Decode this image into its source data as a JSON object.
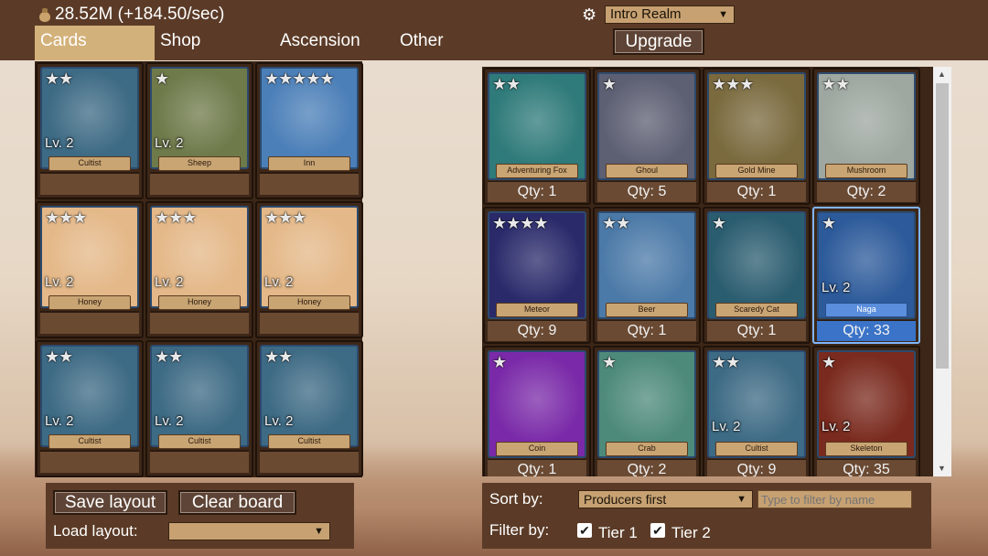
{
  "header": {
    "money_icon": "money-bag-icon",
    "money_text": "28.52M (+184.50/sec)",
    "tabs": [
      "Cards",
      "Shop",
      "Ascension",
      "Other"
    ],
    "settings_icon": "gear-icon",
    "realm_selected": "Intro Realm",
    "upgrade_label": "Upgrade"
  },
  "board": {
    "cards": [
      {
        "name": "Cultist",
        "stars": "★★",
        "level": "Lv. 2",
        "art": "#3d6a84"
      },
      {
        "name": "Sheep",
        "stars": "★",
        "level": "Lv. 2",
        "art": "#6e7a4a"
      },
      {
        "name": "Inn",
        "stars": "★★★★★",
        "level": "",
        "art": "#4b7fb8"
      },
      {
        "name": "Honey",
        "stars": "★★★",
        "level": "Lv. 2",
        "art": "#e4b888"
      },
      {
        "name": "Honey",
        "stars": "★★★",
        "level": "Lv. 2",
        "art": "#e4b888"
      },
      {
        "name": "Honey",
        "stars": "★★★",
        "level": "Lv. 2",
        "art": "#e4b888"
      },
      {
        "name": "Cultist",
        "stars": "★★",
        "level": "Lv. 2",
        "art": "#3d6a84"
      },
      {
        "name": "Cultist",
        "stars": "★★",
        "level": "Lv. 2",
        "art": "#3d6a84"
      },
      {
        "name": "Cultist",
        "stars": "★★",
        "level": "Lv. 2",
        "art": "#3d6a84"
      }
    ]
  },
  "collection": {
    "cards": [
      {
        "name": "Adventuring Fox",
        "stars": "★★",
        "level": "",
        "qty": "Qty: 1",
        "art": "#2f7a7a"
      },
      {
        "name": "Ghoul",
        "stars": "★",
        "level": "",
        "qty": "Qty: 5",
        "art": "#5d5f73"
      },
      {
        "name": "Gold Mine",
        "stars": "★★★",
        "level": "",
        "qty": "Qty: 1",
        "art": "#7a6a3e"
      },
      {
        "name": "Mushroom",
        "stars": "★★",
        "level": "",
        "qty": "Qty: 2",
        "art": "#9ea7a0"
      },
      {
        "name": "Meteor",
        "stars": "★★★★",
        "level": "",
        "qty": "Qty: 9",
        "art": "#2a2a6b"
      },
      {
        "name": "Beer",
        "stars": "★★",
        "level": "",
        "qty": "Qty: 1",
        "art": "#4c7aa8"
      },
      {
        "name": "Scaredy Cat",
        "stars": "★",
        "level": "",
        "qty": "Qty: 1",
        "art": "#2b5d70"
      },
      {
        "name": "Naga",
        "stars": "★",
        "level": "Lv. 2",
        "qty": "Qty: 33",
        "art": "#2c5a9a",
        "highlight": true
      },
      {
        "name": "Coin",
        "stars": "★",
        "level": "",
        "qty": "Qty: 1",
        "art": "#7a2aa8"
      },
      {
        "name": "Crab",
        "stars": "★",
        "level": "",
        "qty": "Qty: 2",
        "art": "#4d8a7a"
      },
      {
        "name": "Cultist",
        "stars": "★★",
        "level": "Lv. 2",
        "qty": "Qty: 9",
        "art": "#3d6a84"
      },
      {
        "name": "Skeleton",
        "stars": "★",
        "level": "Lv. 2",
        "qty": "Qty: 35",
        "art": "#7a2a1e"
      }
    ]
  },
  "layout_panel": {
    "save_label": "Save layout",
    "clear_label": "Clear board",
    "load_label": "Load layout:",
    "load_value": ""
  },
  "sort_panel": {
    "sort_label": "Sort by:",
    "sort_value": "Producers first",
    "filter_placeholder": "Type to filter by name",
    "filter_label": "Filter by:",
    "tier1_label": "Tier 1",
    "tier2_label": "Tier 2"
  }
}
